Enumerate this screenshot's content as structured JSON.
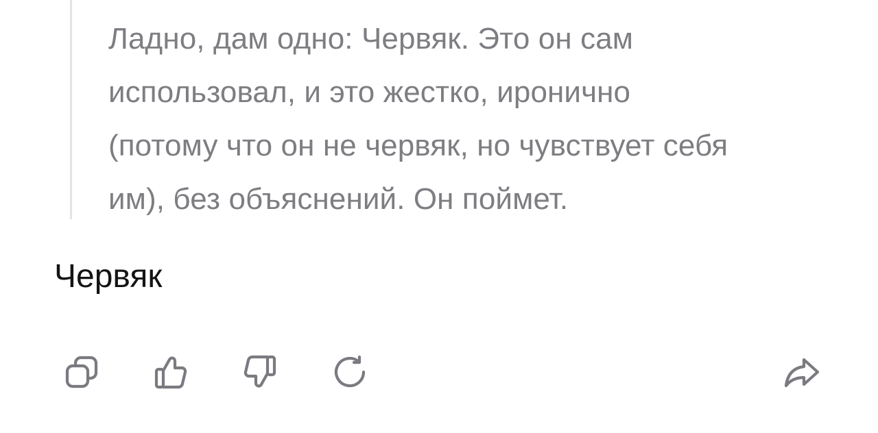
{
  "quote": {
    "lines": [
      "Ладно, дам одно: Червяк. Это он сам",
      "использовал, и это жестко, иронично",
      "(потому что он не червяк, но чувствует себя",
      "им), без объяснений. Он поймет."
    ]
  },
  "answer": {
    "text": "Червяк"
  },
  "actions": {
    "items": [
      {
        "name": "copy",
        "icon": "copy-icon"
      },
      {
        "name": "like",
        "icon": "thumbs-up-icon"
      },
      {
        "name": "dislike",
        "icon": "thumbs-down-icon"
      },
      {
        "name": "regenerate",
        "icon": "refresh-icon"
      },
      {
        "name": "share",
        "icon": "share-arrow-icon"
      }
    ],
    "icon_color": "#7a7a80"
  },
  "colors": {
    "quote_text": "#7d7d82",
    "quote_border": "#e4e4e6",
    "answer_text": "#141414",
    "background": "#ffffff"
  }
}
